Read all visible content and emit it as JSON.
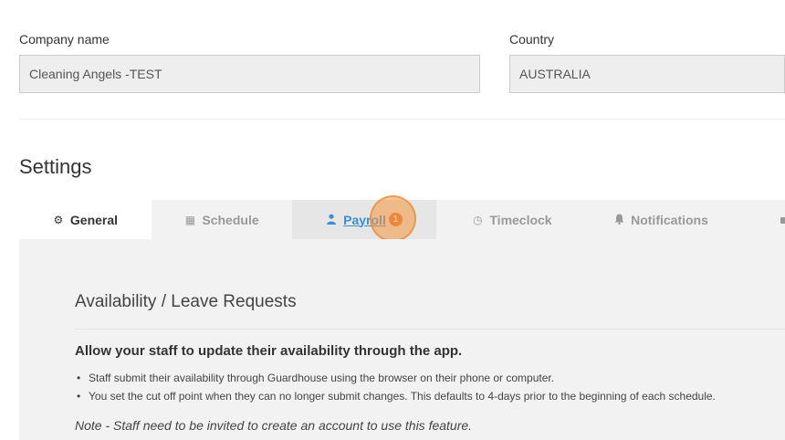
{
  "company": {
    "label": "Company name",
    "value": "Cleaning Angels -TEST"
  },
  "country": {
    "label": "Country",
    "value": "AUSTRALIA"
  },
  "settings": {
    "title": "Settings"
  },
  "tabs": [
    {
      "label": "General",
      "icon": "gear-icon",
      "glyph": "⚙"
    },
    {
      "label": "Schedule",
      "icon": "calendar-icon",
      "glyph": "▦"
    },
    {
      "label": "Payroll",
      "icon": "user-icon",
      "glyph": "▲",
      "badge": "1"
    },
    {
      "label": "Timeclock",
      "icon": "clock-icon",
      "glyph": "◷"
    },
    {
      "label": "Notifications",
      "icon": "bell-icon",
      "glyph": "▲"
    }
  ],
  "panel": {
    "heading": "Availability / Leave Requests",
    "subheading": "Allow your staff to update their availability through the app.",
    "bullets": [
      "Staff submit their availability through Guardhouse using the browser on their phone or computer.",
      "You set the cut off point when they can no longer submit changes. This defaults to 4-days prior to the beginning of each schedule."
    ],
    "note": "Note - Staff need to be invited to create an account to use this feature."
  },
  "colors": {
    "link": "#3a8fd6",
    "badge": "#e0793a",
    "panel_bg": "#f2f2f2"
  }
}
